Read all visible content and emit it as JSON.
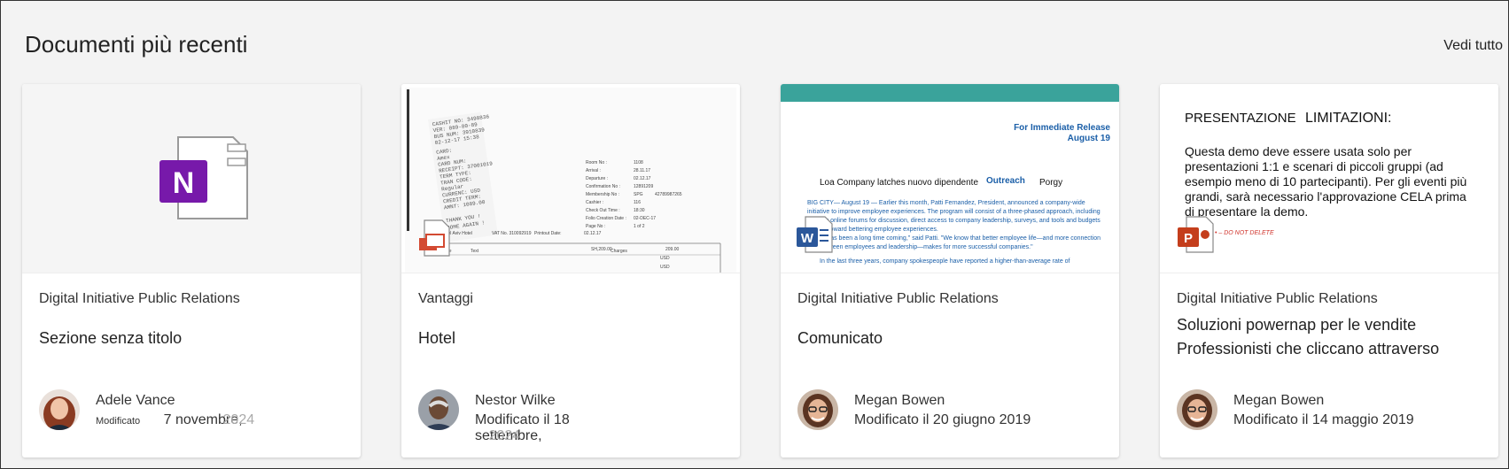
{
  "header": {
    "title": "Documenti più recenti",
    "see_all": "Vedi tutto"
  },
  "cards": [
    {
      "site": "Digital Initiative Public Relations",
      "title": "Sezione senza titolo",
      "author": "Adele Vance",
      "modified_label": "Modificato",
      "modified_date": "7 novembre,",
      "modified_ghost": "2024",
      "app_letter": "N",
      "colors": {
        "app": "#7719aa"
      }
    },
    {
      "site": "Vantaggi",
      "title": "Hotel",
      "author": "Nestor Wilke",
      "modified": "Modificato il 18 settembre,",
      "modified_ghost": "2024",
      "receipt": {
        "room_labels": [
          "Room No :",
          "Arrival :",
          "Departure :",
          "Confirmation No :",
          "Membership No :",
          "Cashier :",
          "Check Out Time :",
          "Folio Creation Date :",
          "Page No :"
        ],
        "room_values": [
          "1108",
          "28.11.17",
          "02.12.17",
          "12891209",
          "SPG",
          "116",
          "18:30",
          "02-DEC-17",
          "1 of 2"
        ],
        "extra_value": "42789987265",
        "vat_line": "VAT No. 310092919",
        "printout": "Printout Date:",
        "printout_date": "02.12.17",
        "hotel": "Tel Aviv Hotel",
        "col_date": "Date",
        "col_text": "Text",
        "col_charges": "Charges",
        "amount_1": "SH,209.00",
        "amount_2": "209.00",
        "usd": "USD",
        "thank_you": "THANK YOU !"
      }
    },
    {
      "site": "Digital Initiative Public Relations",
      "title": "Comunicato",
      "author": "Megan Bowen",
      "modified": "Modificato il 20 giugno 2019",
      "doc": {
        "release": "For Immediate Release",
        "date": "August 19",
        "headline": "Loa Company latches nuovo dipendente",
        "outreach": "Outreach",
        "porgy": "Porgy",
        "para1": "BIG CITY— August 19 — Earlier this month, Patti Fernandez, President, announced a company-wide initiative to improve employee experiences. The program will consist of a three-phased approach, including building online forums for discussion, direct access to company leadership, surveys, and tools and budgets geared toward bettering employee experiences.",
        "para2": "\"It has been a long time coming,\" said Patti. \"We know that better employee life—and more connection between employees and leadership—makes for more successful companies.\"",
        "para3": "In the last three years, company spokespeople have reported a higher-than-average rate of"
      },
      "colors": {
        "teal": "#3aa39b",
        "word": "#2b579a"
      }
    },
    {
      "site": "Digital Initiative Public Relations",
      "title_lines": [
        "Soluzioni powernap per le vendite",
        "Professionisti che cliccano attraverso"
      ],
      "author": "Megan Bowen",
      "modified": "Modificato il 14 maggio 2019",
      "slide": {
        "head1": "PRESENTAZIONE",
        "head2": "LIMITAZIONI:",
        "body": [
          "Questa demo deve essere usata solo per",
          "presentazioni 1:1 e scenari di piccoli gruppi (ad",
          "esempio meno di 10 partecipanti). Per gli eventi più",
          "grandi, sarà necessario l'approvazione CELA prima",
          "di presentare la demo."
        ],
        "tag": "• – DO NOT DELETE"
      },
      "colors": {
        "ppt": "#c43e1c"
      }
    }
  ]
}
